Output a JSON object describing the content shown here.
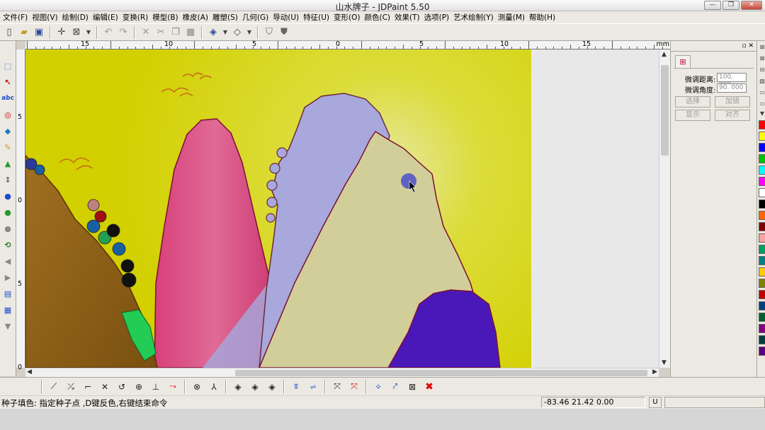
{
  "window": {
    "title": "山水牌子 - JDPaint 5.50"
  },
  "menu": [
    "文件(F)",
    "视图(V)",
    "绘制(D)",
    "编辑(E)",
    "变换(R)",
    "模型(B)",
    "橡皮(A)",
    "雕塑(S)",
    "几何(G)",
    "导动(U)",
    "特征(U)",
    "变形(O)",
    "颜色(C)",
    "效果(T)",
    "选项(P)",
    "艺术绘制(Y)",
    "测量(M)",
    "帮助(H)"
  ],
  "toolbar_icons": [
    "new-icon",
    "open-icon",
    "save-icon",
    "crosshair-icon",
    "view-box-icon",
    "undo-icon",
    "redo-icon",
    "delete-icon",
    "cut-icon",
    "copy-icon",
    "paste-icon",
    "cube-view-icon",
    "cube-wire-icon",
    "shield-icon",
    "shield-filled-icon"
  ],
  "ruler": {
    "unit": "mm",
    "top_labels": [
      "15",
      "10",
      "5",
      "0",
      "5",
      "10",
      "15"
    ],
    "left_labels": [
      "5",
      "0",
      "5",
      "0"
    ]
  },
  "left_tools": [
    "select-rect-icon",
    "node-edit-icon",
    "text-abc-icon",
    "circle-target-icon",
    "eraser-icon",
    "brush-icon",
    "fill-bucket-icon",
    "height-icon",
    "balloon-blue-icon",
    "balloon-green-icon",
    "pin-icon",
    "rotate-icon",
    "arrow-left-icon",
    "arrow-right-icon",
    "layers-icon",
    "grid-icon",
    "cone-icon"
  ],
  "left_tools_text": {
    "abc": "abc"
  },
  "bottom_tools": [
    "line-icon",
    "split-icon",
    "corner-icon",
    "cross-icon",
    "arc-icon",
    "circle-icon",
    "perpendicular-icon",
    "curve-icon",
    "seed-icon",
    "extend-icon",
    "diamond1-icon",
    "diamond2-icon",
    "diamond3-icon",
    "flat-icon",
    "wave-icon",
    "node-x-icon",
    "node-x-red-icon",
    "mesh-icon",
    "mesh-arrow-icon",
    "mesh-x-icon",
    "close-red-icon"
  ],
  "right_panel": {
    "row1_label": "微调距离:",
    "row1_value": "100. 000",
    "row2_label": "微调角度:",
    "row2_value": "90. 000",
    "btn_select": "选择",
    "btn_add": "加锁",
    "btn_show": "显示",
    "btn_align": "对齐"
  },
  "palette_colors": [
    "#ff0000",
    "#ffff00",
    "#0000ff",
    "#00c000",
    "#00ffff",
    "#ff00ff",
    "#ffffff",
    "#000000",
    "#ff6600",
    "#800000",
    "#ffa0a0",
    "#00a060",
    "#008080",
    "#ffcc00",
    "#808000",
    "#c00000",
    "#004080",
    "#006030",
    "#800080",
    "#004040",
    "#5a0080"
  ],
  "status": {
    "message": "种子填色: 指定种子点 ,D键反色,右键结束命令",
    "coords": "-83.46 21.42 0.00",
    "unit_btn": "U"
  }
}
